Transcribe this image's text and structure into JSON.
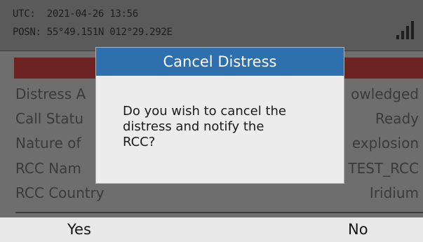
{
  "status_bar": {
    "utc": "UTC:  2021-04-26 13:56",
    "posn": "POSN: 55°49.151N 012°29.292E",
    "signal_icon": "signal-strength-icon"
  },
  "rows": [
    {
      "label": "Distress A",
      "value": "owledged"
    },
    {
      "label": "Call Statu",
      "value": "Ready"
    },
    {
      "label": "Nature of",
      "value": "explosion"
    },
    {
      "label": "RCC Nam",
      "value": "TEST_RCC"
    },
    {
      "label": "RCC Country",
      "value": "Iridium"
    }
  ],
  "dialog": {
    "title": "Cancel Distress",
    "message": "Do you wish to cancel the\ndistress and notify the\nRCC?"
  },
  "softkeys": {
    "yes": "Yes",
    "no": "No"
  },
  "colors": {
    "dialog_title_bg": "#2e6fae",
    "banner": "#6e2323",
    "background": "#6e6e6e"
  }
}
